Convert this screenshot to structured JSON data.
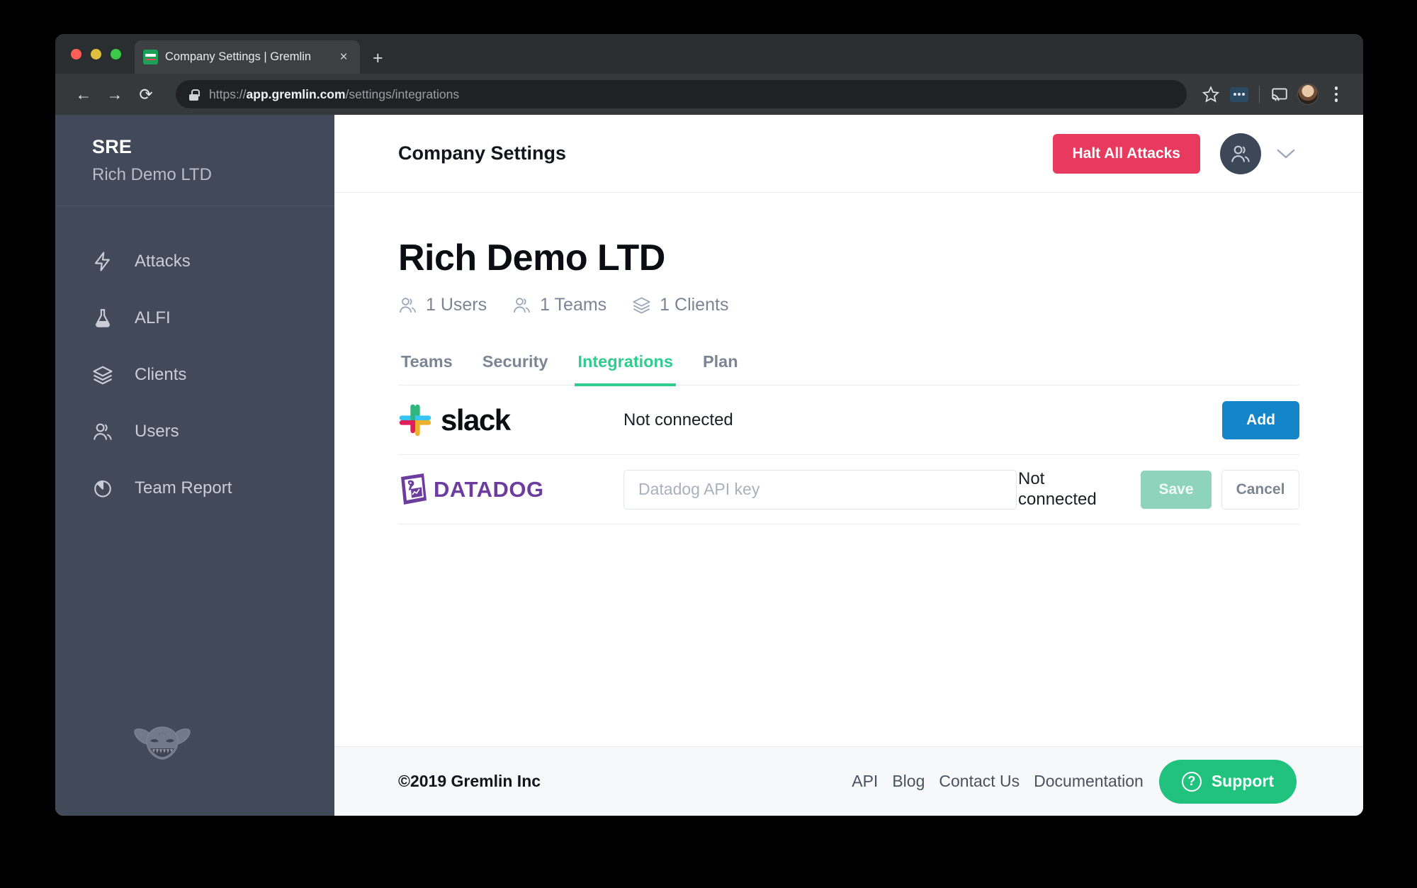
{
  "browser": {
    "tab": {
      "title": "Company Settings | Gremlin",
      "favicon": "gremlin-favicon",
      "close": "×"
    },
    "new_tab_label": "+",
    "url": {
      "scheme": "https://",
      "host": "app.gremlin.com",
      "path": "/settings/integrations"
    },
    "nav": {
      "back": "←",
      "forward": "→",
      "reload": "⟳"
    }
  },
  "sidebar": {
    "brand_title": "SRE",
    "brand_sub": "Rich Demo LTD",
    "items": [
      {
        "label": "Attacks",
        "icon": "bolt-icon"
      },
      {
        "label": "ALFI",
        "icon": "flask-icon"
      },
      {
        "label": "Clients",
        "icon": "layers-icon"
      },
      {
        "label": "Users",
        "icon": "users-icon"
      },
      {
        "label": "Team Report",
        "icon": "pie-chart-icon"
      }
    ],
    "logo": "gremlin-logo"
  },
  "topbar": {
    "title": "Company Settings",
    "halt_label": "Halt All Attacks",
    "avatar_icon": "user-avatar-icon",
    "chevron_icon": "chevron-down-icon"
  },
  "main": {
    "page_title": "Rich Demo LTD",
    "stats": [
      {
        "label": "1 Users",
        "icon": "users-icon"
      },
      {
        "label": "1 Teams",
        "icon": "users-icon"
      },
      {
        "label": "1 Clients",
        "icon": "layers-icon"
      }
    ],
    "tabs": [
      {
        "label": "Teams",
        "active": false
      },
      {
        "label": "Security",
        "active": false
      },
      {
        "label": "Integrations",
        "active": true
      },
      {
        "label": "Plan",
        "active": false
      }
    ],
    "integrations": [
      {
        "name": "slack",
        "logo_text": "slack",
        "status": "Not connected",
        "action_label": "Add"
      },
      {
        "name": "datadog",
        "logo_text": "DATADOG",
        "input_placeholder": "Datadog API key",
        "input_value": "",
        "status": "Not connected",
        "save_label": "Save",
        "cancel_label": "Cancel"
      }
    ]
  },
  "footer": {
    "copyright": "©2019 Gremlin Inc",
    "links": [
      "API",
      "Blog",
      "Contact Us",
      "Documentation"
    ],
    "support_label": "Support",
    "support_icon": "question-circle-icon"
  },
  "colors": {
    "accent_green": "#2ecc8f",
    "danger_red": "#e8395f",
    "add_blue": "#1485c8",
    "save_green": "#8ed4bd",
    "support_green": "#21c17e",
    "sidebar_bg": "#424a5a"
  }
}
